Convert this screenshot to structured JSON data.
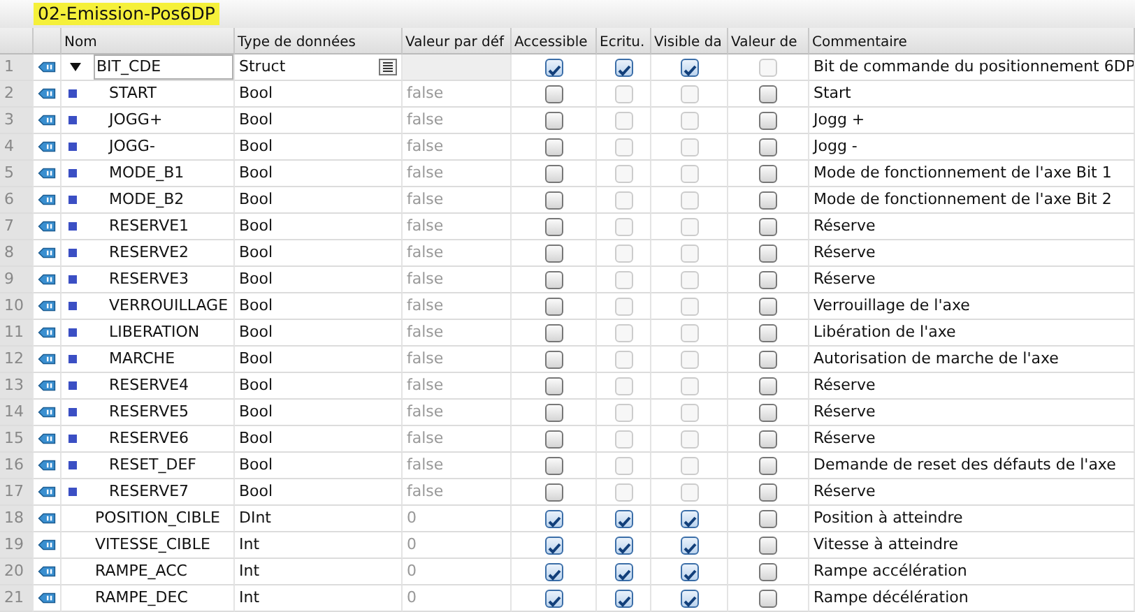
{
  "title": "02-Emission-Pos6DP",
  "columns": [
    "Nom",
    "Type de données",
    "Valeur par déf",
    "Accessible",
    "Ecritu.",
    "Visible da",
    "Valeur de",
    "Commentaire"
  ],
  "rows": [
    {
      "num": "1",
      "kind": "struct",
      "expanded": true,
      "selected": true,
      "name": "BIT_CDE",
      "type": "Struct",
      "default": "",
      "accessible": {
        "checked": true,
        "disabled": false
      },
      "writable": {
        "checked": true,
        "disabled": false
      },
      "visible": {
        "checked": true,
        "disabled": false
      },
      "setpoint": {
        "checked": false,
        "disabled": true
      },
      "comment": "Bit de commande du positionnement 6DP"
    },
    {
      "num": "2",
      "kind": "member",
      "selected": false,
      "name": "START",
      "type": "Bool",
      "default": "false",
      "accessible": {
        "checked": false,
        "disabled": false
      },
      "writable": {
        "checked": false,
        "disabled": true
      },
      "visible": {
        "checked": false,
        "disabled": true
      },
      "setpoint": {
        "checked": false,
        "disabled": false
      },
      "comment": "Start"
    },
    {
      "num": "3",
      "kind": "member",
      "selected": false,
      "name": "JOGG+",
      "type": "Bool",
      "default": "false",
      "accessible": {
        "checked": false,
        "disabled": false
      },
      "writable": {
        "checked": false,
        "disabled": true
      },
      "visible": {
        "checked": false,
        "disabled": true
      },
      "setpoint": {
        "checked": false,
        "disabled": false
      },
      "comment": "Jogg +"
    },
    {
      "num": "4",
      "kind": "member",
      "selected": false,
      "name": "JOGG-",
      "type": "Bool",
      "default": "false",
      "accessible": {
        "checked": false,
        "disabled": false
      },
      "writable": {
        "checked": false,
        "disabled": true
      },
      "visible": {
        "checked": false,
        "disabled": true
      },
      "setpoint": {
        "checked": false,
        "disabled": false
      },
      "comment": "Jogg -"
    },
    {
      "num": "5",
      "kind": "member",
      "selected": false,
      "name": "MODE_B1",
      "type": "Bool",
      "default": "false",
      "accessible": {
        "checked": false,
        "disabled": false
      },
      "writable": {
        "checked": false,
        "disabled": true
      },
      "visible": {
        "checked": false,
        "disabled": true
      },
      "setpoint": {
        "checked": false,
        "disabled": false
      },
      "comment": "Mode de fonctionnement de l'axe Bit 1"
    },
    {
      "num": "6",
      "kind": "member",
      "selected": false,
      "name": "MODE_B2",
      "type": "Bool",
      "default": "false",
      "accessible": {
        "checked": false,
        "disabled": false
      },
      "writable": {
        "checked": false,
        "disabled": true
      },
      "visible": {
        "checked": false,
        "disabled": true
      },
      "setpoint": {
        "checked": false,
        "disabled": false
      },
      "comment": "Mode de fonctionnement de l'axe Bit 2"
    },
    {
      "num": "7",
      "kind": "member",
      "selected": false,
      "name": "RESERVE1",
      "type": "Bool",
      "default": "false",
      "accessible": {
        "checked": false,
        "disabled": false
      },
      "writable": {
        "checked": false,
        "disabled": true
      },
      "visible": {
        "checked": false,
        "disabled": true
      },
      "setpoint": {
        "checked": false,
        "disabled": false
      },
      "comment": "Réserve"
    },
    {
      "num": "8",
      "kind": "member",
      "selected": false,
      "name": "RESERVE2",
      "type": "Bool",
      "default": "false",
      "accessible": {
        "checked": false,
        "disabled": false
      },
      "writable": {
        "checked": false,
        "disabled": true
      },
      "visible": {
        "checked": false,
        "disabled": true
      },
      "setpoint": {
        "checked": false,
        "disabled": false
      },
      "comment": "Réserve"
    },
    {
      "num": "9",
      "kind": "member",
      "selected": false,
      "name": "RESERVE3",
      "type": "Bool",
      "default": "false",
      "accessible": {
        "checked": false,
        "disabled": false
      },
      "writable": {
        "checked": false,
        "disabled": true
      },
      "visible": {
        "checked": false,
        "disabled": true
      },
      "setpoint": {
        "checked": false,
        "disabled": false
      },
      "comment": "Réserve"
    },
    {
      "num": "10",
      "kind": "member",
      "selected": false,
      "name": "VERROUILLAGE",
      "type": "Bool",
      "default": "false",
      "accessible": {
        "checked": false,
        "disabled": false
      },
      "writable": {
        "checked": false,
        "disabled": true
      },
      "visible": {
        "checked": false,
        "disabled": true
      },
      "setpoint": {
        "checked": false,
        "disabled": false
      },
      "comment": "Verrouillage de l'axe"
    },
    {
      "num": "11",
      "kind": "member",
      "selected": false,
      "name": "LIBERATION",
      "type": "Bool",
      "default": "false",
      "accessible": {
        "checked": false,
        "disabled": false
      },
      "writable": {
        "checked": false,
        "disabled": true
      },
      "visible": {
        "checked": false,
        "disabled": true
      },
      "setpoint": {
        "checked": false,
        "disabled": false
      },
      "comment": "Libération de l'axe"
    },
    {
      "num": "12",
      "kind": "member",
      "selected": false,
      "name": "MARCHE",
      "type": "Bool",
      "default": "false",
      "accessible": {
        "checked": false,
        "disabled": false
      },
      "writable": {
        "checked": false,
        "disabled": true
      },
      "visible": {
        "checked": false,
        "disabled": true
      },
      "setpoint": {
        "checked": false,
        "disabled": false
      },
      "comment": "Autorisation de marche de l'axe"
    },
    {
      "num": "13",
      "kind": "member",
      "selected": false,
      "name": "RESERVE4",
      "type": "Bool",
      "default": "false",
      "accessible": {
        "checked": false,
        "disabled": false
      },
      "writable": {
        "checked": false,
        "disabled": true
      },
      "visible": {
        "checked": false,
        "disabled": true
      },
      "setpoint": {
        "checked": false,
        "disabled": false
      },
      "comment": "Réserve"
    },
    {
      "num": "14",
      "kind": "member",
      "selected": false,
      "name": "RESERVE5",
      "type": "Bool",
      "default": "false",
      "accessible": {
        "checked": false,
        "disabled": false
      },
      "writable": {
        "checked": false,
        "disabled": true
      },
      "visible": {
        "checked": false,
        "disabled": true
      },
      "setpoint": {
        "checked": false,
        "disabled": false
      },
      "comment": "Réserve"
    },
    {
      "num": "15",
      "kind": "member",
      "selected": false,
      "name": "RESERVE6",
      "type": "Bool",
      "default": "false",
      "accessible": {
        "checked": false,
        "disabled": false
      },
      "writable": {
        "checked": false,
        "disabled": true
      },
      "visible": {
        "checked": false,
        "disabled": true
      },
      "setpoint": {
        "checked": false,
        "disabled": false
      },
      "comment": "Réserve"
    },
    {
      "num": "16",
      "kind": "member",
      "selected": false,
      "name": "RESET_DEF",
      "type": "Bool",
      "default": "false",
      "accessible": {
        "checked": false,
        "disabled": false
      },
      "writable": {
        "checked": false,
        "disabled": true
      },
      "visible": {
        "checked": false,
        "disabled": true
      },
      "setpoint": {
        "checked": false,
        "disabled": false
      },
      "comment": "Demande de reset des défauts de l'axe"
    },
    {
      "num": "17",
      "kind": "member",
      "selected": false,
      "name": "RESERVE7",
      "type": "Bool",
      "default": "false",
      "accessible": {
        "checked": false,
        "disabled": false
      },
      "writable": {
        "checked": false,
        "disabled": true
      },
      "visible": {
        "checked": false,
        "disabled": true
      },
      "setpoint": {
        "checked": false,
        "disabled": false
      },
      "comment": "Réserve"
    },
    {
      "num": "18",
      "kind": "var",
      "selected": false,
      "name": "POSITION_CIBLE",
      "type": "DInt",
      "default": "0",
      "accessible": {
        "checked": true,
        "disabled": false
      },
      "writable": {
        "checked": true,
        "disabled": false
      },
      "visible": {
        "checked": true,
        "disabled": false
      },
      "setpoint": {
        "checked": false,
        "disabled": false
      },
      "comment": "Position à atteindre"
    },
    {
      "num": "19",
      "kind": "var",
      "selected": false,
      "name": "VITESSE_CIBLE",
      "type": "Int",
      "default": "0",
      "accessible": {
        "checked": true,
        "disabled": false
      },
      "writable": {
        "checked": true,
        "disabled": false
      },
      "visible": {
        "checked": true,
        "disabled": false
      },
      "setpoint": {
        "checked": false,
        "disabled": false
      },
      "comment": "Vitesse à atteindre"
    },
    {
      "num": "20",
      "kind": "var",
      "selected": false,
      "name": "RAMPE_ACC",
      "type": "Int",
      "default": "0",
      "accessible": {
        "checked": true,
        "disabled": false
      },
      "writable": {
        "checked": true,
        "disabled": false
      },
      "visible": {
        "checked": true,
        "disabled": false
      },
      "setpoint": {
        "checked": false,
        "disabled": false
      },
      "comment": "Rampe accélération"
    },
    {
      "num": "21",
      "kind": "var",
      "selected": false,
      "name": "RAMPE_DEC",
      "type": "Int",
      "default": "0",
      "accessible": {
        "checked": true,
        "disabled": false
      },
      "writable": {
        "checked": true,
        "disabled": false
      },
      "visible": {
        "checked": true,
        "disabled": false
      },
      "setpoint": {
        "checked": false,
        "disabled": false
      },
      "comment": "Rampe décélération"
    }
  ]
}
